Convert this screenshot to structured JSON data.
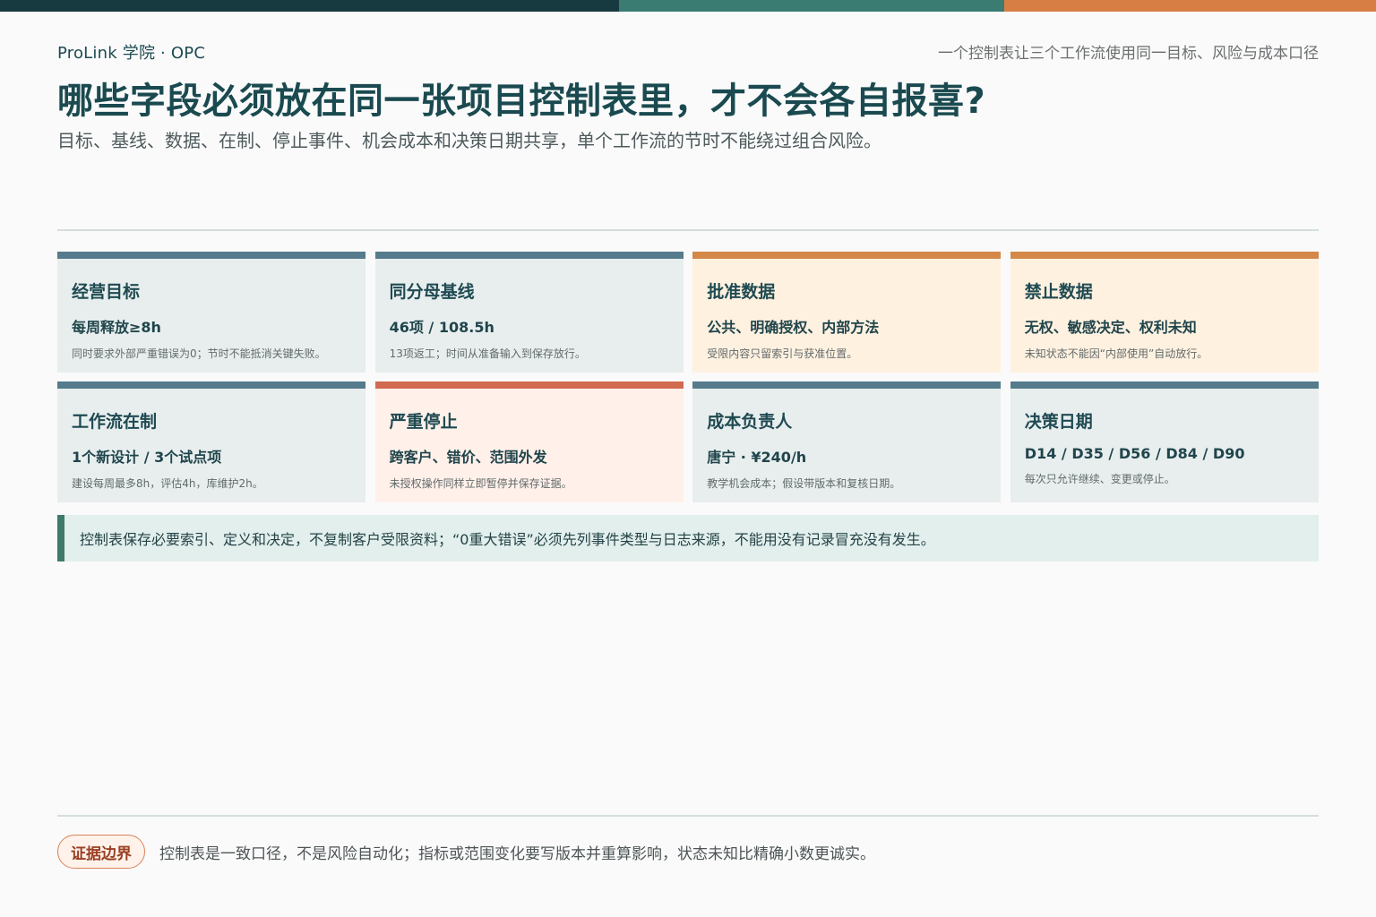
{
  "header": {
    "brand": "ProLink 学院 · OPC",
    "tagline": "一个控制表让三个工作流使用同一目标、风险与成本口径",
    "title": "哪些字段必须放在同一张项目控制表里，才不会各自报喜?",
    "subtitle": "目标、基线、数据、在制、停止事件、机会成本和决策日期共享，单个工作流的节时不能绕过组合风险。"
  },
  "cards": [
    {
      "label": "经营目标",
      "value": "每周释放≥8h",
      "note": "同时要求外部严重错误为0；节时不能抵消关键失败。"
    },
    {
      "label": "同分母基线",
      "value": "46项 / 108.5h",
      "note": "13项返工；时间从准备输入到保存放行。"
    },
    {
      "label": "批准数据",
      "value": "公共、明确授权、内部方法",
      "note": "受限内容只留索引与获准位置。"
    },
    {
      "label": "禁止数据",
      "value": "无权、敏感决定、权利未知",
      "note": "未知状态不能因“内部使用”自动放行。"
    },
    {
      "label": "工作流在制",
      "value": "1个新设计 / 3个试点项",
      "note": "建设每周最多8h，评估4h，库维护2h。"
    },
    {
      "label": "严重停止",
      "value": "跨客户、错价、范围外发",
      "note": "未授权操作同样立即暂停并保存证据。"
    },
    {
      "label": "成本负责人",
      "value": "唐宁 · ¥240/h",
      "note": "教学机会成本；假设带版本和复核日期。"
    },
    {
      "label": "决策日期",
      "value": "D14 / D35 / D56 / D84 / D90",
      "note": "每次只允许继续、变更或停止。"
    }
  ],
  "callout": "控制表保存必要索引、定义和决定，不复制客户受限资料；“0重大错误”必须先列事件类型与日志来源，不能用没有记录冒充没有发生。",
  "footer": {
    "badge": "证据边界",
    "text": "控制表是一致口径，不是风险自动化；指标或范围变化要写版本并重算影响，状态未知比精确小数更诚实。"
  },
  "colors": {
    "accent_dark": "#173a40",
    "accent_teal": "#3a7b72",
    "accent_orange": "#d77e45",
    "card_blue_bar": "#557b8c",
    "card_warm_bar": "#d4894a",
    "card_alert_bar": "#d26a50"
  }
}
